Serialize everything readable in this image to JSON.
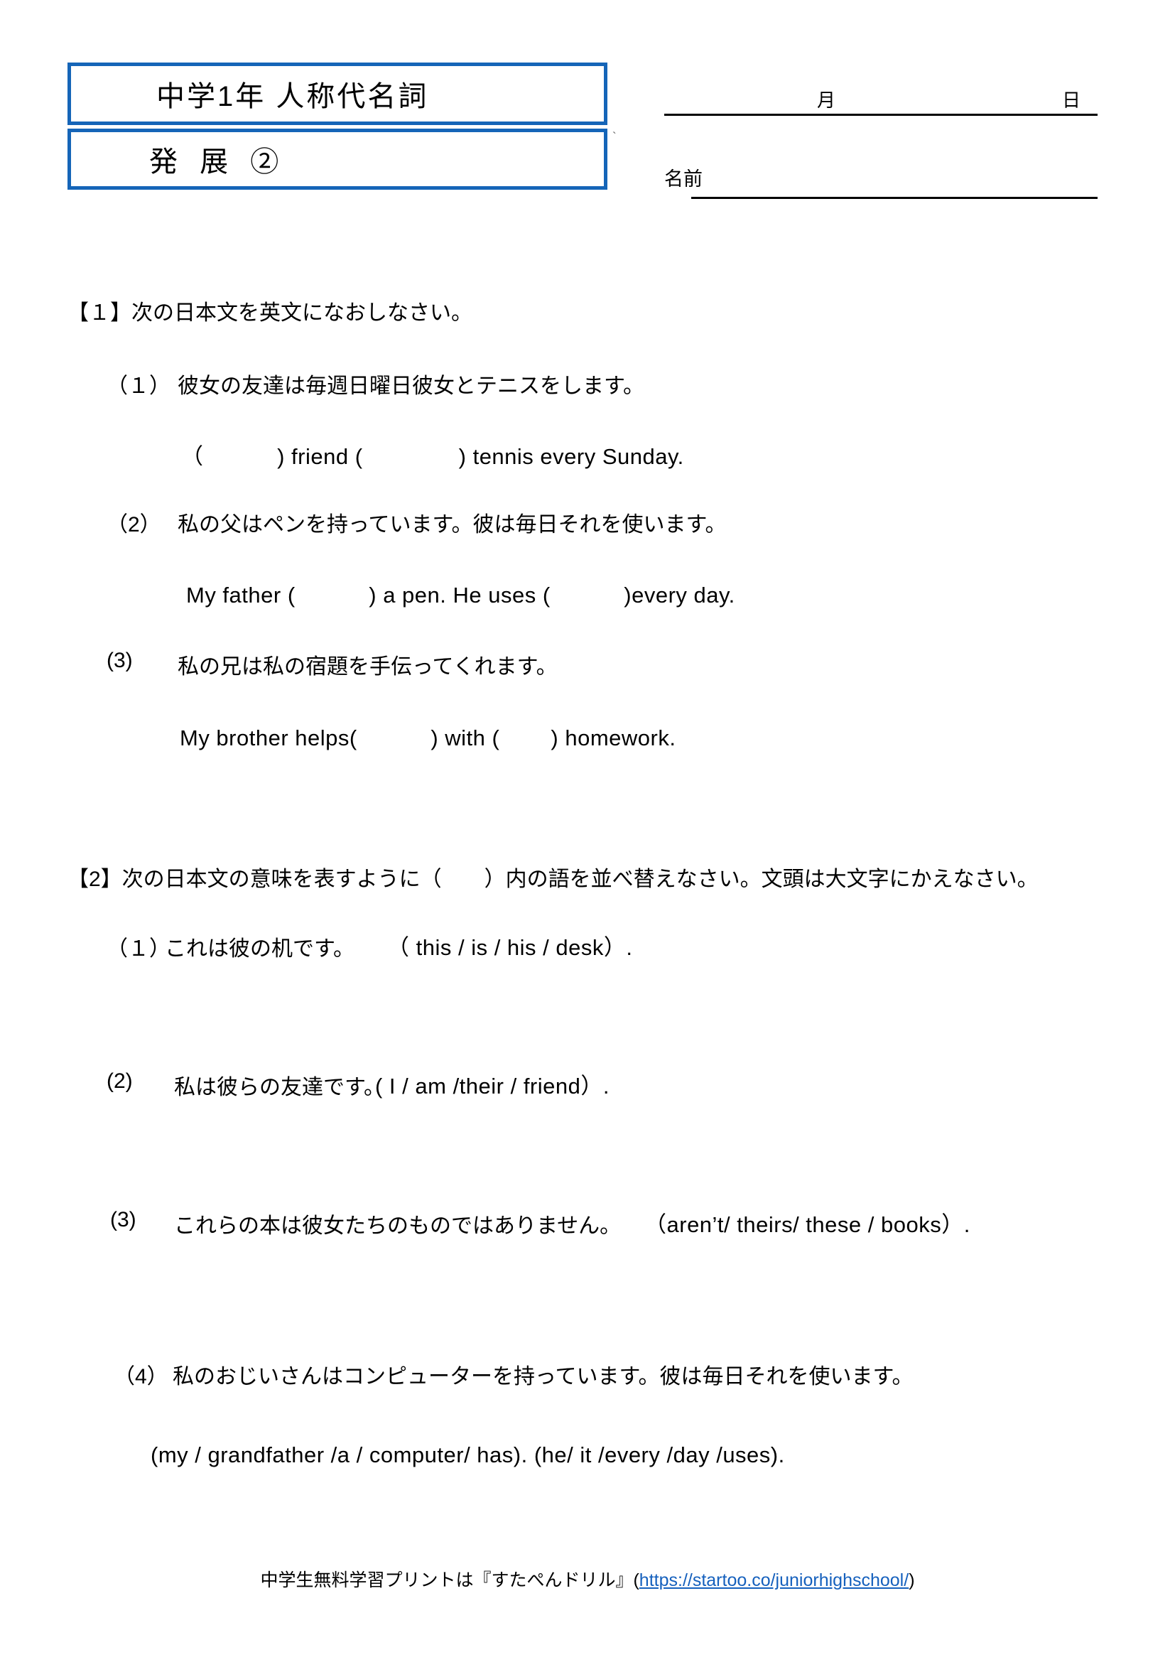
{
  "header": {
    "title_main": "中学1年 人称代名詞",
    "title_level": "発 展 ②",
    "date_month_label": "月",
    "date_day_label": "日",
    "name_label": "名前",
    "accent_color": "#1565b8"
  },
  "section1": {
    "heading": "【１】次の日本文を英文になおしなさい。",
    "items": [
      {
        "number": "（１）",
        "jp": "彼女の友達は毎週日曜日彼女とテニスをします。",
        "en": "（　　　  ) friend (　　　　   ) tennis every Sunday."
      },
      {
        "number": "（2）",
        "jp": "私の父はペンを持っています。彼は毎日それを使います。",
        "en": "My father (　　　   ) a pen. He uses (　　　    )every day."
      },
      {
        "number": "(3)",
        "jp": "私の兄は私の宿題を手伝ってくれます。",
        "en": "My brother helps(　　　  ) with (　　   ) homework."
      }
    ]
  },
  "section2": {
    "heading": "【2】次の日本文の意味を表すように（　　）内の語を並べ替えなさい。文頭は大文字にかえなさい。",
    "items": [
      {
        "number": "（１）",
        "jp": "これは彼の机です。",
        "words": "（ this / is  / his / desk）."
      },
      {
        "number": "(2)",
        "jp": "私は彼らの友達です。",
        "words": "( I / am /their / friend）."
      },
      {
        "number": "(3)",
        "jp": "これらの本は彼女たちのものではありません。",
        "words": "（aren’t/ theirs/  these / books）."
      },
      {
        "number": "（4）",
        "jp": "私のおじいさんはコンピューターを持っています。彼は毎日それを使います。",
        "words": "(my / grandfather /a / computer/ has). (he/ it /every /day /uses)."
      }
    ]
  },
  "footer": {
    "text_before": "中学生無料学習プリントは『すたぺんドリル』(",
    "url": "https://startoo.co/juniorhighschool/",
    "text_after": ")",
    "link_color": "#1560bd"
  }
}
